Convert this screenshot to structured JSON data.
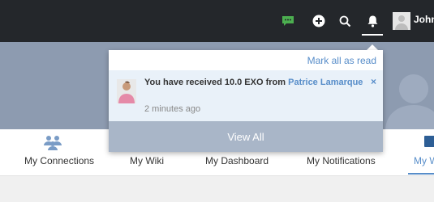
{
  "colors": {
    "topbar_bg": "#24272b",
    "accent": "#578dc9",
    "chat_green": "#4caf50",
    "banner_bg": "#8d9bb0",
    "view_all_bg": "#a9b6c8",
    "notif_unread_bg": "#e9f1f9"
  },
  "topbar": {
    "icons": [
      "chat-icon",
      "plus-icon",
      "search-icon",
      "bell-icon",
      "avatar"
    ],
    "user_name": "John"
  },
  "notifications_popup": {
    "mark_all_label": "Mark all as read",
    "items": [
      {
        "text": "You have received 10.0 EXO from ",
        "link_text": "Patrice Lamarque",
        "time": "2 minutes ago",
        "close": "×"
      }
    ],
    "view_all_label": "View All"
  },
  "nav": {
    "items": [
      {
        "label": "My Connections"
      },
      {
        "label": "My Wiki"
      },
      {
        "label": "My Dashboard"
      },
      {
        "label": "My Notifications"
      },
      {
        "label": "My W"
      }
    ]
  }
}
